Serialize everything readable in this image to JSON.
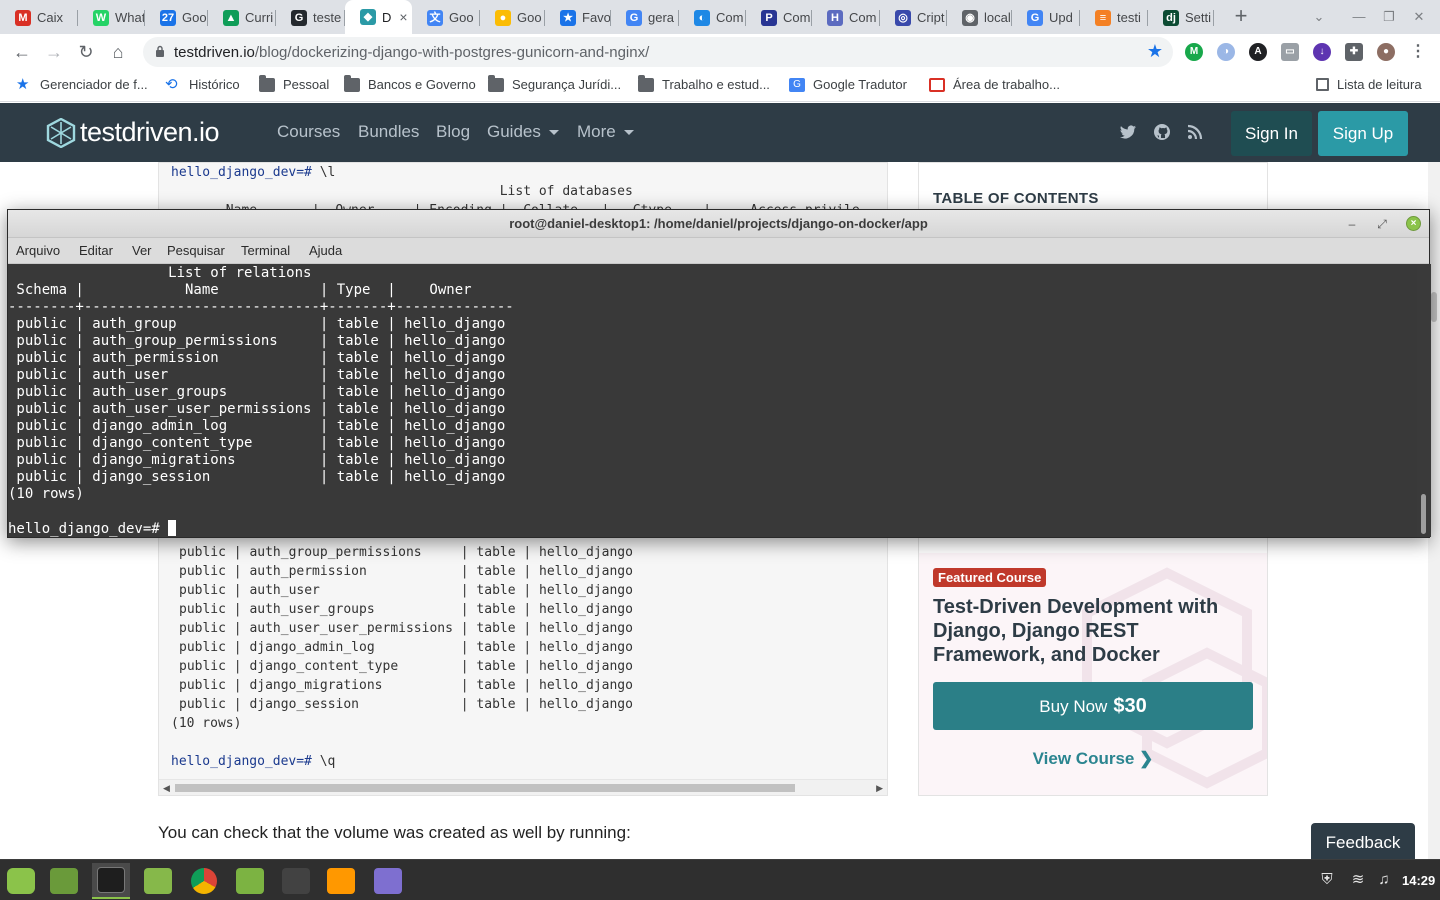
{
  "browser": {
    "tabs": [
      {
        "label": "Caix",
        "color": "#d93025",
        "glyph": "M"
      },
      {
        "label": "What",
        "color": "#25d366",
        "glyph": "W"
      },
      {
        "label": "Goo",
        "color": "#1a73e8",
        "glyph": "27"
      },
      {
        "label": "Curri",
        "color": "#0f9d58",
        "glyph": "▲"
      },
      {
        "label": "teste",
        "color": "#24292e",
        "glyph": "G"
      },
      {
        "label": "D",
        "color": "#2b9aa6",
        "glyph": "◆"
      },
      {
        "label": "Goo",
        "color": "#4285f4",
        "glyph": "文"
      },
      {
        "label": "Goo",
        "color": "#fbbc04",
        "glyph": "●"
      },
      {
        "label": "Favo",
        "color": "#1a73e8",
        "glyph": "★"
      },
      {
        "label": "gera",
        "color": "#4285f4",
        "glyph": "G"
      },
      {
        "label": "Com",
        "color": "#1e88e5",
        "glyph": "◐"
      },
      {
        "label": "Com",
        "color": "#283593",
        "glyph": "P"
      },
      {
        "label": "Com",
        "color": "#5c6bc0",
        "glyph": "H"
      },
      {
        "label": "Cript",
        "color": "#3949ab",
        "glyph": "◎"
      },
      {
        "label": "local",
        "color": "#5f6368",
        "glyph": "◉"
      },
      {
        "label": "Upd",
        "color": "#4285f4",
        "glyph": "G"
      },
      {
        "label": "testi",
        "color": "#f48024",
        "glyph": "≡"
      },
      {
        "label": "Setti",
        "color": "#0c4b33",
        "glyph": "dj"
      }
    ],
    "active_tab_close": "×",
    "url_host": "testdriven.io",
    "url_path": "/blog/dockerizing-django-with-postgres-gunicorn-and-nginx/",
    "bookmarks": [
      {
        "label": "Gerenciador de f...",
        "icon": "star-icon"
      },
      {
        "label": "Histórico",
        "icon": "history-icon"
      },
      {
        "label": "Pessoal",
        "icon": "folder-icon"
      },
      {
        "label": "Bancos e Governo",
        "icon": "folder-icon"
      },
      {
        "label": "Segurança Jurídi...",
        "icon": "folder-icon"
      },
      {
        "label": "Trabalho e estud...",
        "icon": "folder-icon"
      },
      {
        "label": "Google Tradutor",
        "icon": "translate-icon"
      },
      {
        "label": "Área de trabalho...",
        "icon": "remote-desktop-icon"
      }
    ],
    "reading_list": "Lista de leitura"
  },
  "site": {
    "logo_text": "testdriven.io",
    "nav": [
      "Courses",
      "Bundles",
      "Blog",
      "Guides",
      "More"
    ],
    "sign_in": "Sign In",
    "sign_up": "Sign Up"
  },
  "code_block": {
    "top_lines": [
      {
        "prompt": "hello_django_dev=#",
        "cmd": " \\l"
      },
      {
        "prompt": "",
        "cmd": "                                          List of databases"
      },
      {
        "prompt": "",
        "cmd": "       Name       |  Owner     | Encoding |  Collate   |   Ctype    |     Access privile"
      }
    ],
    "rows": [
      "public | auth_group_permissions     | table | hello_django",
      "public | auth_permission            | table | hello_django",
      "public | auth_user                  | table | hello_django",
      "public | auth_user_groups           | table | hello_django",
      "public | auth_user_user_permissions | table | hello_django",
      "public | django_admin_log           | table | hello_django",
      "public | django_content_type        | table | hello_django",
      "public | django_migrations          | table | hello_django",
      "public | django_session             | table | hello_django"
    ],
    "row_count": "(10 rows)",
    "last_prompt": "hello_django_dev=#",
    "last_cmd": " \\q"
  },
  "sidebar": {
    "toc_title": "TABLE OF CONTENTS",
    "featured_badge": "Featured Course",
    "featured_title": "Test-Driven Development with Django, Django REST Framework, and Docker",
    "buy_label": "Buy Now",
    "buy_price": "$30",
    "view_course": "View Course"
  },
  "page": {
    "body_text": "You can check that the volume was created as well by running:",
    "feedback": "Feedback"
  },
  "terminal": {
    "title": "root@daniel-desktop1: /home/daniel/projects/django-on-docker/app",
    "menu": [
      "Arquivo",
      "Editar",
      "Ver",
      "Pesquisar",
      "Terminal",
      "Ajuda"
    ],
    "lines": [
      "                   List of relations",
      " Schema |            Name            | Type  |    Owner",
      "--------+----------------------------+-------+--------------",
      " public | auth_group                 | table | hello_django",
      " public | auth_group_permissions     | table | hello_django",
      " public | auth_permission            | table | hello_django",
      " public | auth_user                  | table | hello_django",
      " public | auth_user_groups           | table | hello_django",
      " public | auth_user_user_permissions | table | hello_django",
      " public | django_admin_log           | table | hello_django",
      " public | django_content_type        | table | hello_django",
      " public | django_migrations          | table | hello_django",
      " public | django_session             | table | hello_django",
      "(10 rows)",
      ""
    ],
    "prompt": "hello_django_dev=# "
  },
  "taskbar": {
    "apps": [
      {
        "name": "mint-menu-icon",
        "color": "#8bc34a"
      },
      {
        "name": "show-desktop-icon",
        "color": "#6a9a3a"
      },
      {
        "name": "terminal-icon",
        "color": "#1e1e1e"
      },
      {
        "name": "files-icon",
        "color": "#86b84a"
      },
      {
        "name": "chrome-icon",
        "color": "#db4437"
      },
      {
        "name": "software-manager-icon",
        "color": "#7cb342"
      },
      {
        "name": "calculator-icon",
        "color": "#424242"
      },
      {
        "name": "media-player-icon",
        "color": "#ff9800"
      },
      {
        "name": "text-editor-icon",
        "color": "#7e6fd0"
      }
    ],
    "clock": "14:29"
  }
}
